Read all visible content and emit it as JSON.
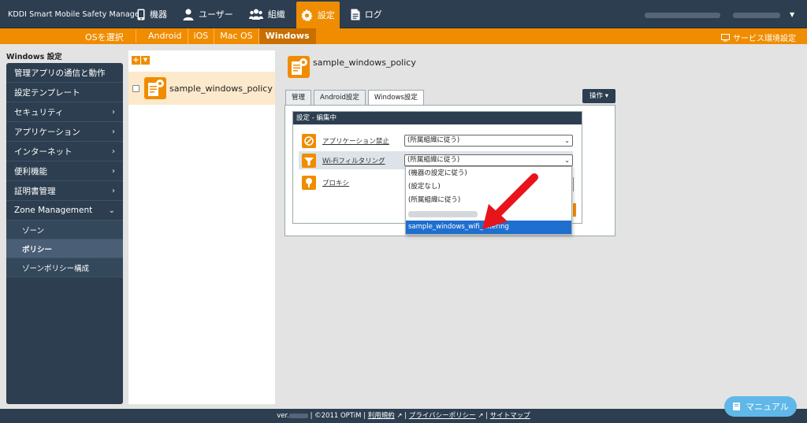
{
  "header": {
    "brand": "KDDI Smart Mobile Safety Manager",
    "nav": [
      {
        "label": "機器",
        "icon": "phone-icon"
      },
      {
        "label": "ユーザー",
        "icon": "user-icon"
      },
      {
        "label": "組織",
        "icon": "group-icon"
      },
      {
        "label": "設定",
        "icon": "gear-icon",
        "active": true
      },
      {
        "label": "ログ",
        "icon": "document-icon"
      }
    ]
  },
  "subnav": {
    "os_select": "OSを選択",
    "tabs": [
      "Android",
      "iOS",
      "Mac OS",
      "Windows"
    ],
    "active_tab": "Windows",
    "service": "サービス環境設定"
  },
  "sidebar": {
    "title": "Windows 設定",
    "items": [
      {
        "label": "管理アプリの通信と動作",
        "chevron": ""
      },
      {
        "label": "設定テンプレート",
        "chevron": ""
      },
      {
        "label": "セキュリティ",
        "chevron": "›"
      },
      {
        "label": "アプリケーション",
        "chevron": "›"
      },
      {
        "label": "インターネット",
        "chevron": "›"
      },
      {
        "label": "便利機能",
        "chevron": "›"
      },
      {
        "label": "証明書管理",
        "chevron": "›"
      },
      {
        "label": "Zone Management",
        "chevron": "⌄"
      }
    ],
    "subitems": [
      "ゾーン",
      "ポリシー",
      "ゾーンポリシー構成"
    ],
    "active_sub": "ポリシー"
  },
  "policy_list": {
    "items": [
      "sample_windows_policy"
    ]
  },
  "main": {
    "title": "sample_windows_policy",
    "tabs": [
      "管理",
      "Android設定",
      "Windows設定"
    ],
    "active_tab": "Windows設定",
    "ops_label": "操作 ▾",
    "panel_title": "設定 - 編集中",
    "rows": [
      {
        "label": "アプリケーション禁止",
        "value": "(所属組織に従う)",
        "icon": "app-block-icon"
      },
      {
        "label": "Wi-Fiフィルタリング",
        "value": "(所属組織に従う)",
        "icon": "wifi-filter-icon"
      },
      {
        "label": "プロキシ",
        "value": "",
        "icon": "proxy-icon"
      }
    ]
  },
  "dropdown": {
    "options": [
      "(機器の設定に従う)",
      "(設定なし)",
      "(所属組織に従う)",
      "",
      "sample_windows_wifi_filtering"
    ],
    "selected_index": 4
  },
  "footer": {
    "ver_prefix": "ver.",
    "copyright": "| ©2011 OPTiM |",
    "terms": "利用規約",
    "privacy": "プライバシーポリシー",
    "sitemap": "サイトマップ",
    "sep": "|"
  },
  "manual": {
    "label": "マニュアル"
  },
  "colors": {
    "navy": "#2c3e50",
    "orange": "#f08c00",
    "select_blue": "#1e6fcf",
    "arrow_red": "#e8141b"
  }
}
